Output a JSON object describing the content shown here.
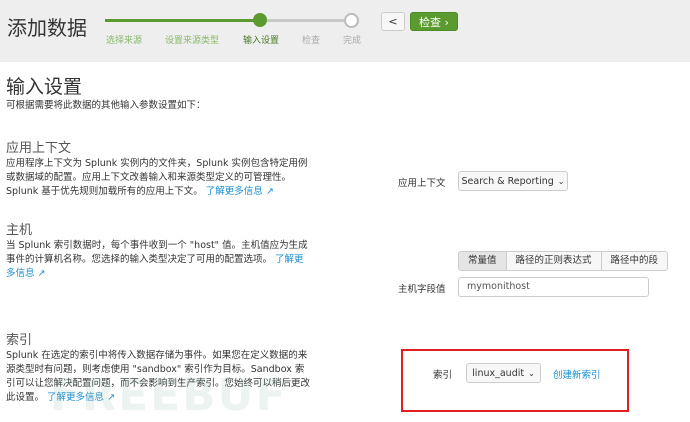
{
  "header": {
    "title": "添加数据",
    "steps": [
      "选择来源",
      "设置来源类型",
      "输入设置",
      "检查",
      "完成"
    ],
    "current_step": 3,
    "back_label": "<",
    "next_label": "检查 ›",
    "accent": "#5a9a2e"
  },
  "page": {
    "title": "输入设置",
    "subtitle": "可根据需要将此数据的其他输入参数设置如下："
  },
  "app_context": {
    "heading": "应用上下文",
    "text": "应用程序上下文为 Splunk 实例内的文件夹，Splunk 实例包含特定用例或数据域的配置。应用上下文改善输入和来源类型定义的可管理性。Splunk 基于优先规则加载所有的应用上下文。",
    "link": "了解更多信息",
    "field_label": "应用上下文",
    "value": "Search & Reporting"
  },
  "host": {
    "heading": "主机",
    "text": "当 Splunk 索引数据时，每个事件收到一个 \"host\" 值。主机值应为生成事件的计算机名称。您选择的输入类型决定了可用的配置选项。",
    "link": "了解更多信息",
    "modes": [
      "常量值",
      "路径的正则表达式",
      "路径中的段"
    ],
    "field_label": "主机字段值",
    "value": "mymonithost"
  },
  "index": {
    "heading": "索引",
    "text": "Splunk 在选定的索引中将传入数据存储为事件。如果您在定义数据的来源类型时有问题，则考虑使用 \"sandbox\" 索引作为目标。Sandbox 索引可以让您解决配置问题，而不会影响到生产索引。您始终可以稍后更改此设置。",
    "link": "了解更多信息",
    "field_label": "索引",
    "value": "linux_audit",
    "create_link": "创建新索引"
  },
  "watermark": "FREEBUF"
}
